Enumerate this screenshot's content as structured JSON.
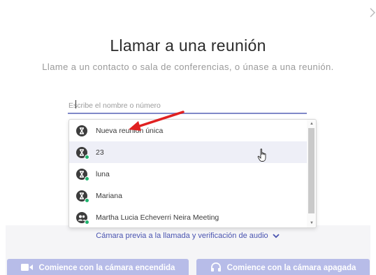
{
  "header": {
    "title": "Llamar a una reunión",
    "subtitle": "Llame a un contacto o sala de conferencias, o únase a una reunión."
  },
  "search": {
    "placeholder": "Escribe el nombre o número",
    "value": ""
  },
  "results": [
    {
      "label": "Nueva reunión única",
      "icon": "hourglass-icon",
      "online": false
    },
    {
      "label": "23",
      "icon": "hourglass-icon",
      "online": true
    },
    {
      "label": "luna",
      "icon": "hourglass-icon",
      "online": true
    },
    {
      "label": "Mariana",
      "icon": "hourglass-icon",
      "online": true
    },
    {
      "label": "Martha Lucia Echeverri Neira Meeting",
      "icon": "group-icon",
      "online": true
    }
  ],
  "preview_link": "Cámara previa a la llamada y verificación de audio",
  "buttons": {
    "camera_on": "Comience con la cámara encendida",
    "camera_off": "Comience con la cámara apagada"
  },
  "colors": {
    "accent": "#4a54b0",
    "online": "#1fb36d",
    "button_disabled": "#b7bce8",
    "annotation_arrow": "#e02020"
  }
}
